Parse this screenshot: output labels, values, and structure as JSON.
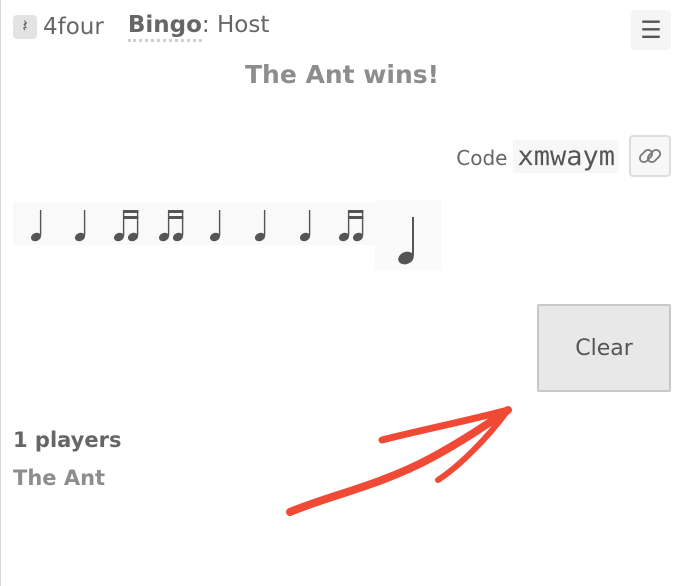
{
  "app": {
    "logo_icon": "quarter-rest-icon",
    "name": "4four"
  },
  "page": {
    "game": "Bingo",
    "separator": ":",
    "role": "Host"
  },
  "menu": {
    "icon": "hamburger-menu-icon"
  },
  "status": {
    "message": "The Ant wins!"
  },
  "session": {
    "code_label": "Code",
    "code": "xmwaym",
    "copy_link_icon": "link-icon"
  },
  "rhythm": {
    "notes": [
      "quarter",
      "quarter",
      "sixteenth-pair",
      "sixteenth-pair",
      "quarter",
      "quarter",
      "quarter",
      "sixteenth-pair"
    ],
    "next_note": "quarter"
  },
  "actions": {
    "clear_label": "Clear"
  },
  "players": {
    "count_label": "1 players",
    "list": [
      "The Ant"
    ]
  },
  "colors": {
    "text": "#595959",
    "muted": "#8d8d8d",
    "annotation": "#f04a36",
    "button_bg": "#e8e8e8"
  }
}
